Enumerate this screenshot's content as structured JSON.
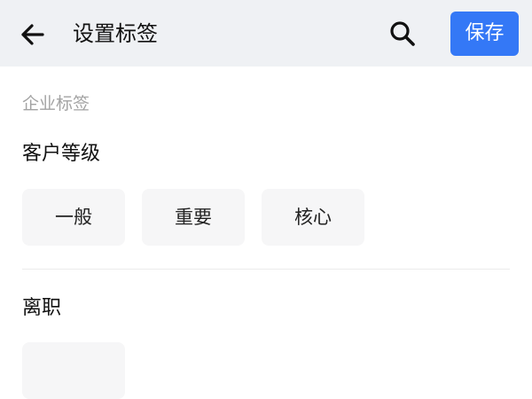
{
  "header": {
    "title": "设置标签",
    "back_icon": "arrow-left-icon",
    "search_icon": "search-icon",
    "save_label": "保存",
    "save_color": "#3478f6",
    "background": "#eff1f4"
  },
  "section": {
    "label": "企业标签"
  },
  "groups": [
    {
      "title": "客户等级",
      "tags": [
        "一般",
        "重要",
        "核心"
      ]
    },
    {
      "title": "离职",
      "tags": [
        ""
      ]
    }
  ]
}
